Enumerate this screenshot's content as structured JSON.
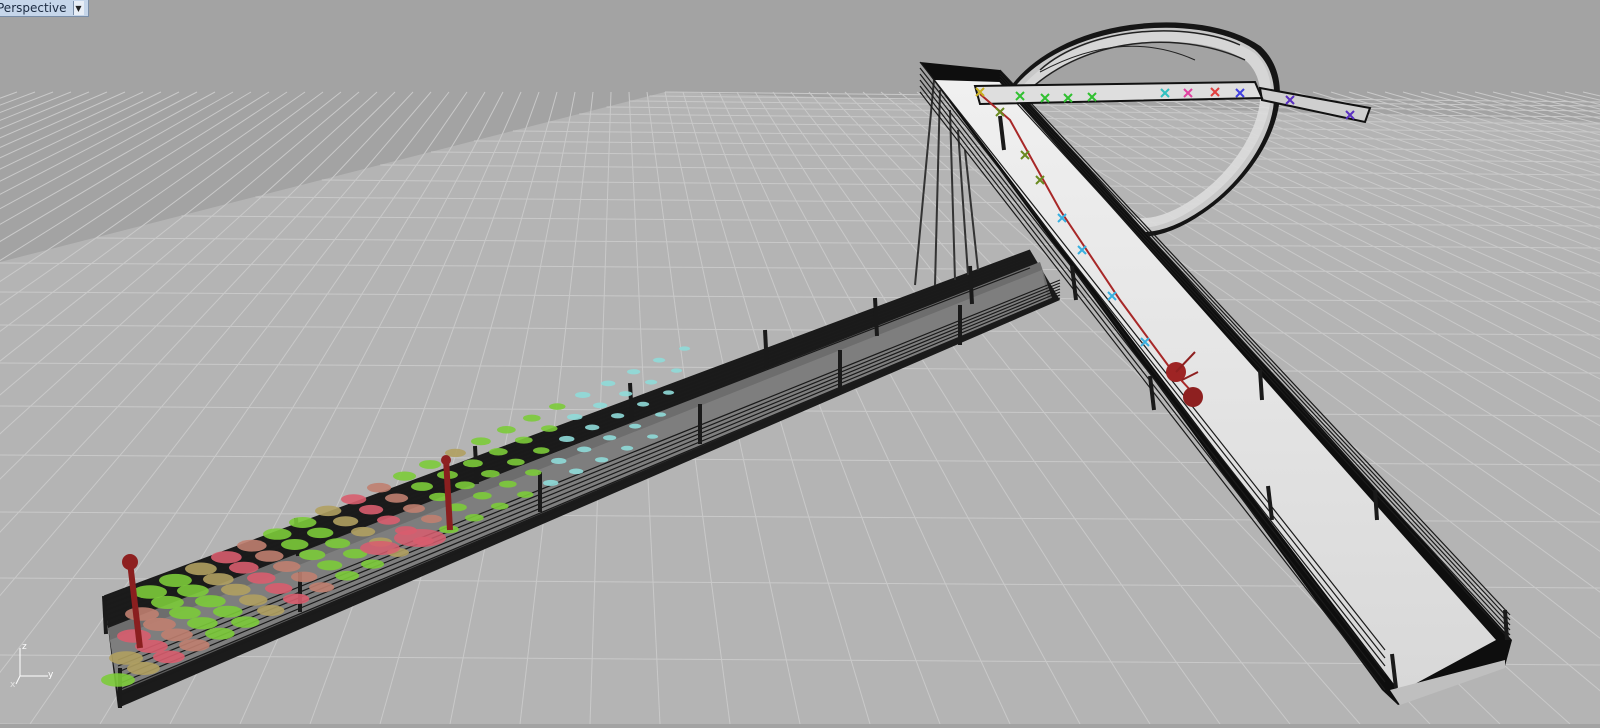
{
  "viewport": {
    "title": "Perspective",
    "menu_icon": "dropdown-arrow-icon",
    "background": "#a3a3a3",
    "grid_color": "#b9b9b9",
    "grid_major_color": "#8f8f8f"
  },
  "axes": {
    "z": "z",
    "y": "y",
    "x": "x"
  },
  "model": {
    "description_colors": {
      "deck": "#e4e4e4",
      "railing": "#111111",
      "path": "#b03030",
      "marker_green": "#7ccb3a",
      "marker_red": "#d85d6e",
      "marker_cyan": "#8fdad8",
      "marker_blue": "#3a5cdd"
    }
  }
}
